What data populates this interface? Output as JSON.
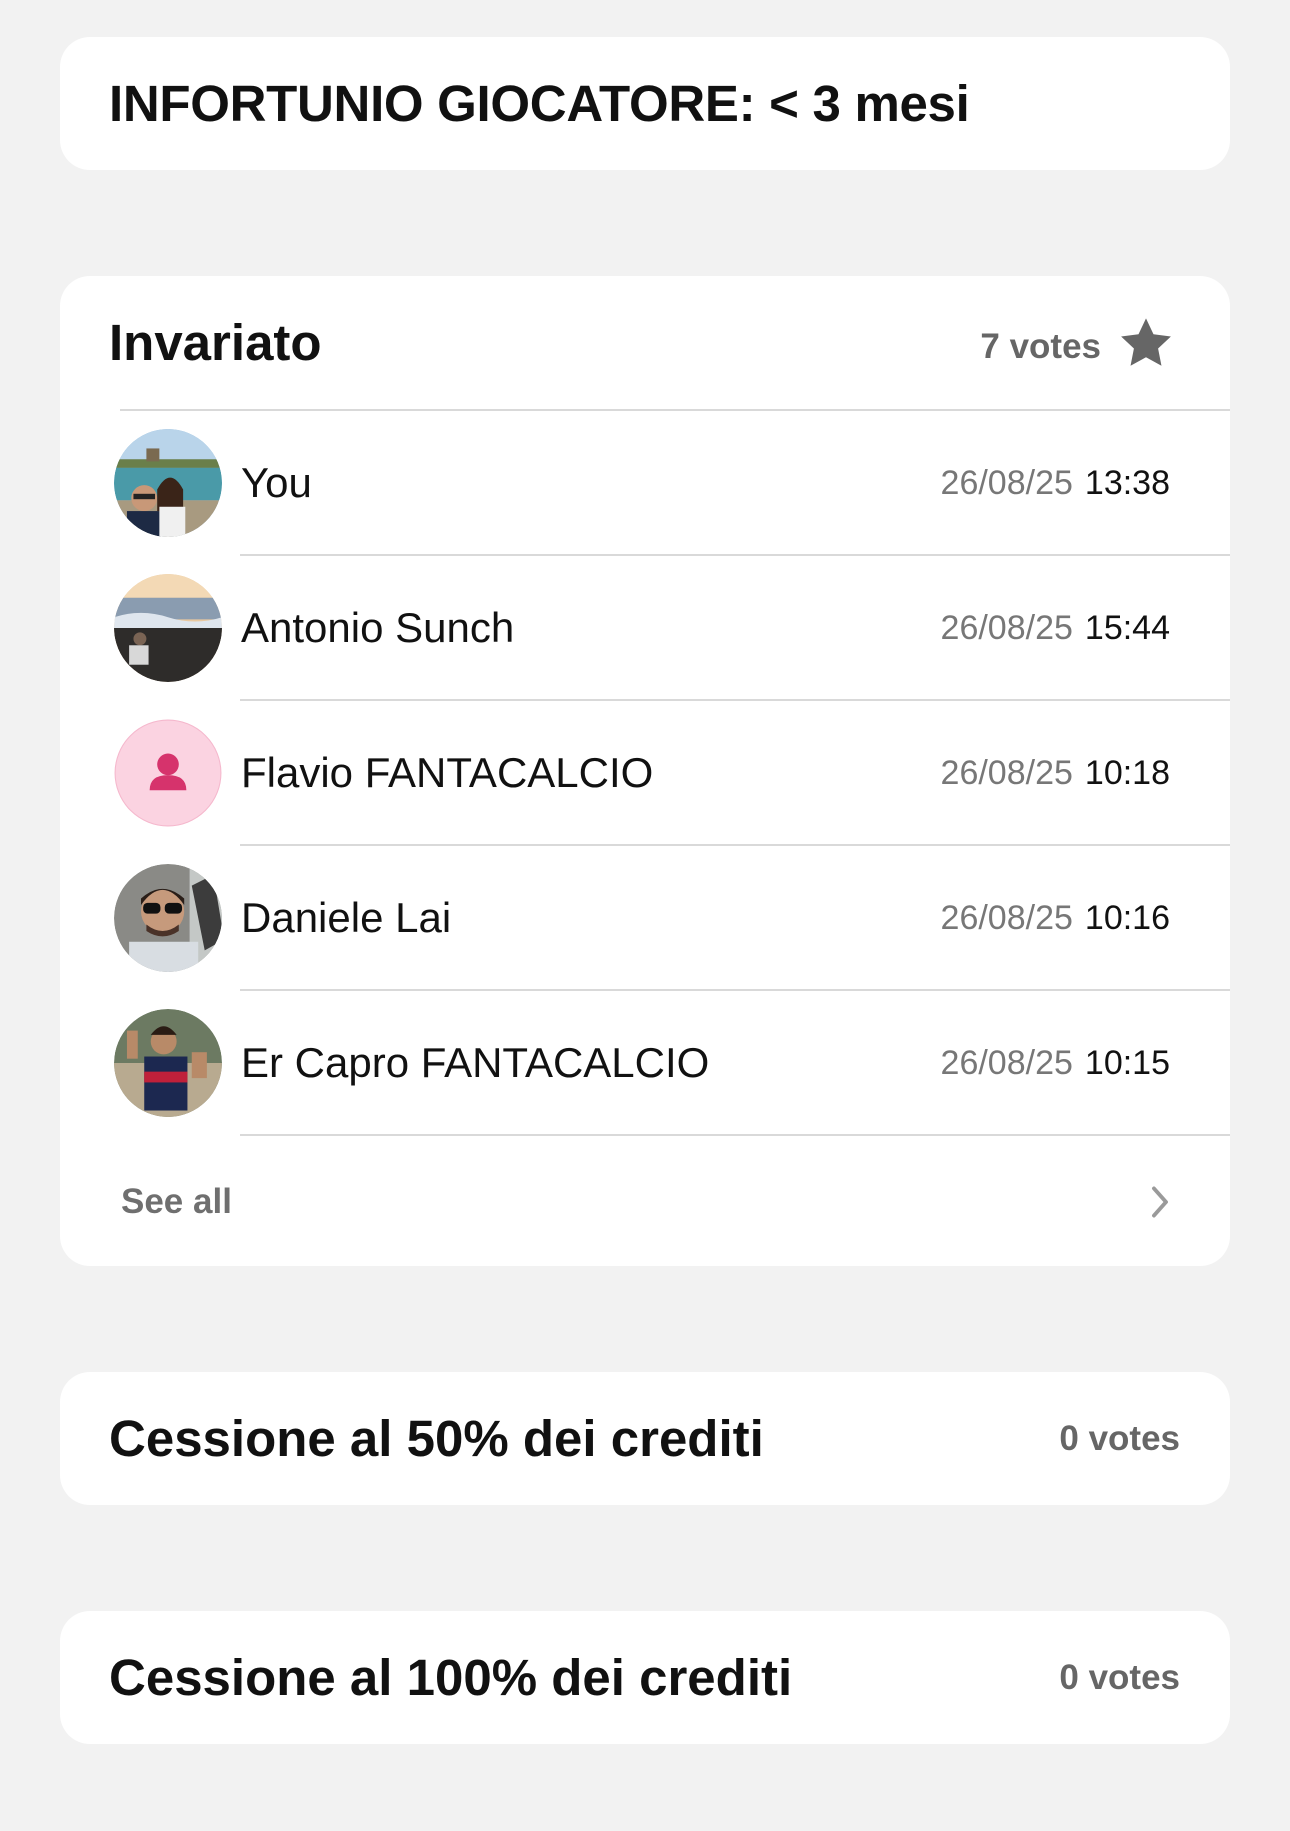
{
  "question": {
    "title": "INFORTUNIO GIOCATORE: < 3 mesi"
  },
  "options": [
    {
      "title": "Invariato",
      "votes": "7 votes",
      "starred": true,
      "voters": [
        {
          "name": "You",
          "date": "26/08/25",
          "time": "13:38",
          "avatar": "photo-couple-sea"
        },
        {
          "name": "Antonio Sunch",
          "date": "26/08/25",
          "time": "15:44",
          "avatar": "photo-seaside-sunset"
        },
        {
          "name": "Flavio FANTACALCIO",
          "date": "26/08/25",
          "time": "10:18",
          "avatar": "person-placeholder-icon"
        },
        {
          "name": "Daniele Lai",
          "date": "26/08/25",
          "time": "10:16",
          "avatar": "photo-man-sunglasses"
        },
        {
          "name": "Er Capro FANTACALCIO",
          "date": "26/08/25",
          "time": "10:15",
          "avatar": "photo-man-jersey"
        }
      ],
      "see_all_label": "See all"
    },
    {
      "title": "Cessione al 50% dei crediti",
      "votes": "0 votes"
    },
    {
      "title": "Cessione al 100% dei crediti",
      "votes": "0 votes"
    }
  ],
  "colors": {
    "background": "#f2f2f2",
    "card": "#ffffff",
    "placeholder_avatar_bg": "#fbd3e1",
    "placeholder_avatar_fg": "#d6336c",
    "star": "#666666"
  }
}
